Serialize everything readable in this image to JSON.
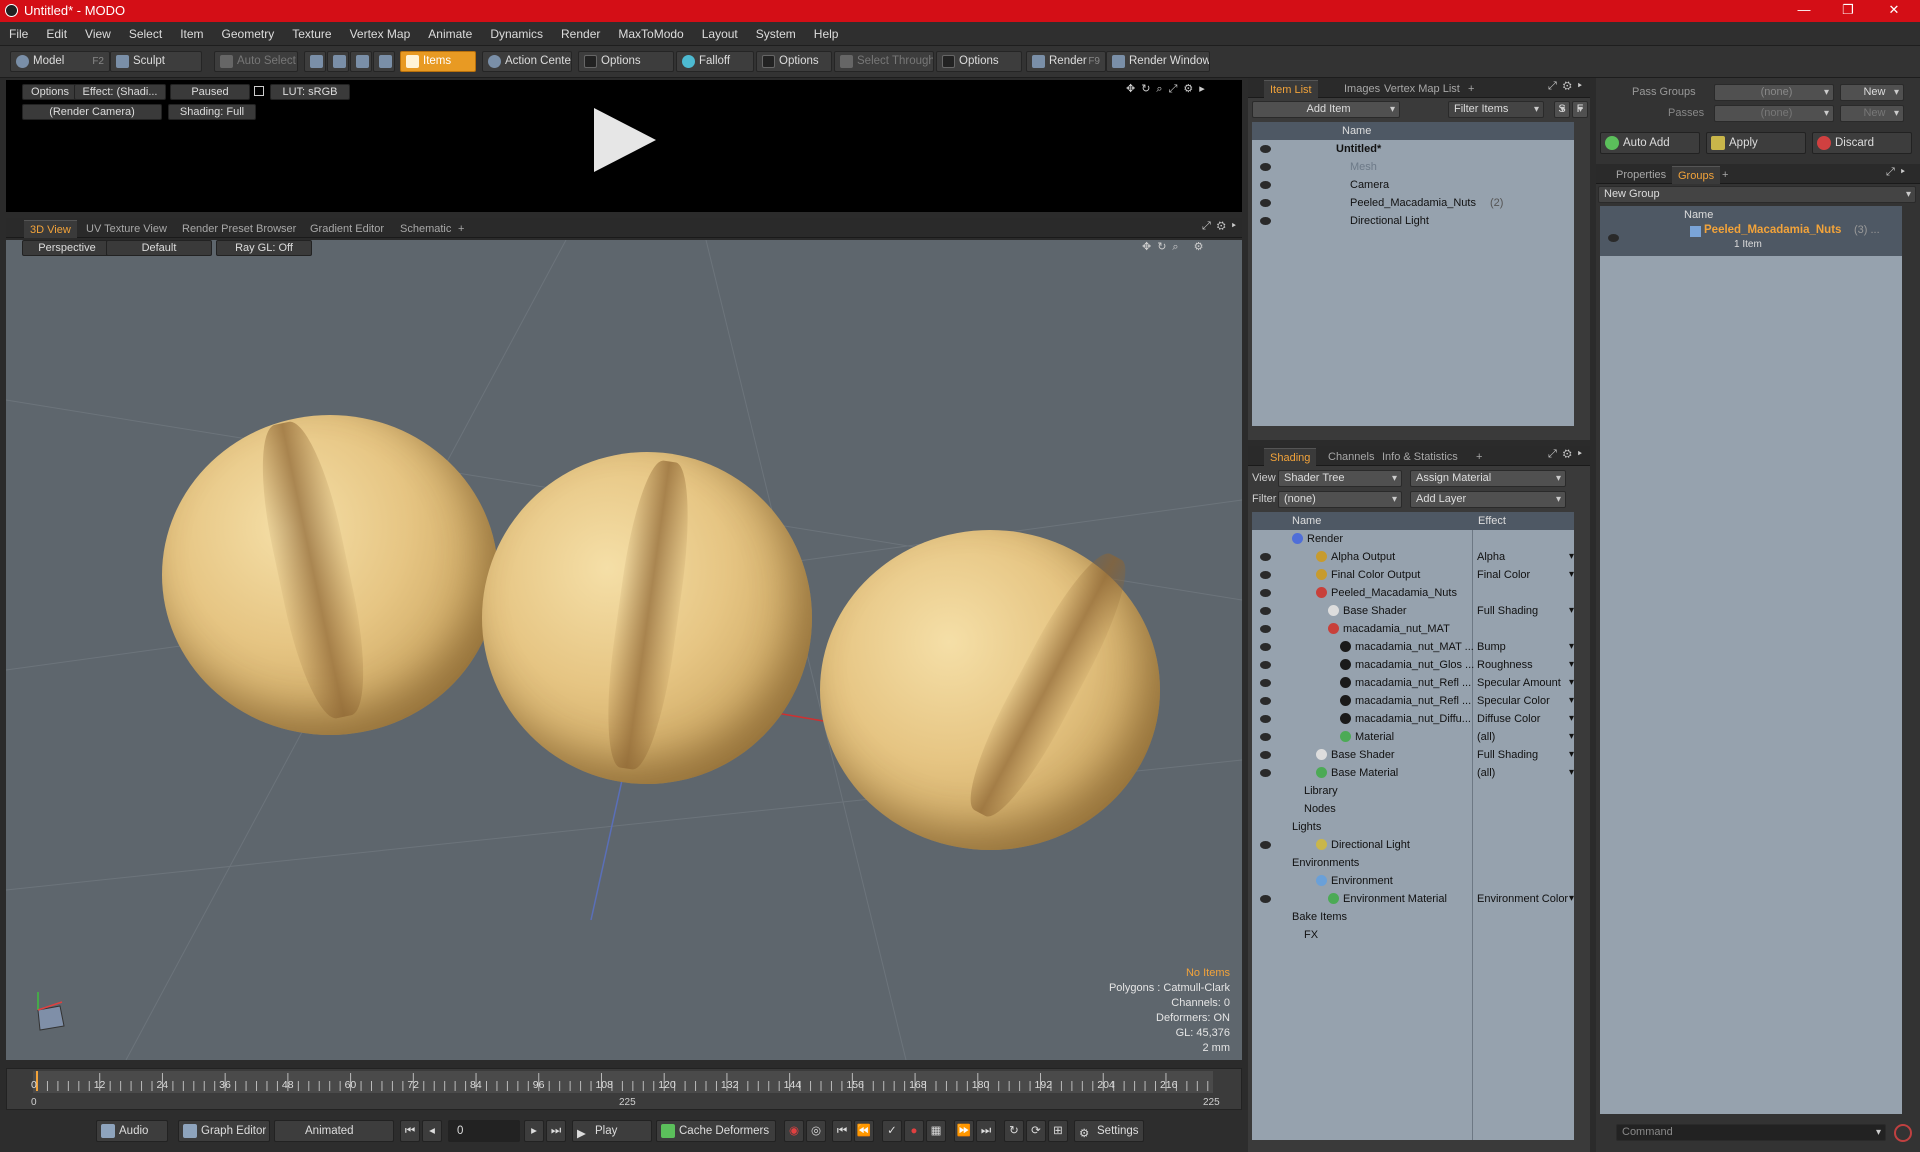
{
  "window": {
    "title": "Untitled* - MODO",
    "controls": [
      "—",
      "❐",
      "✕"
    ]
  },
  "menu": [
    "File",
    "Edit",
    "View",
    "Select",
    "Item",
    "Geometry",
    "Texture",
    "Vertex Map",
    "Animate",
    "Dynamics",
    "Render",
    "MaxToModo",
    "Layout",
    "System",
    "Help"
  ],
  "toolbar": {
    "model": "Model",
    "model_key": "F2",
    "sculpt": "Sculpt",
    "auto_select": "Auto Select",
    "items": "Items",
    "action_center": "Action Center",
    "options1": "Options",
    "falloff": "Falloff",
    "options2": "Options",
    "select_through": "Select Through",
    "options3": "Options",
    "render": "Render",
    "render_key": "F9",
    "render_window": "Render Window"
  },
  "preview": {
    "options": "Options",
    "effect": "Effect: (Shadi...",
    "paused": "Paused",
    "lut": "LUT: sRGB",
    "camera": "(Render Camera)",
    "shading": "Shading: Full"
  },
  "view_tabs": [
    "3D View",
    "UV Texture View",
    "Render Preset Browser",
    "Gradient Editor",
    "Schematic",
    "+"
  ],
  "view3d": {
    "perspective": "Perspective",
    "default": "Default",
    "raygl": "Ray GL: Off",
    "hud": {
      "no_items": "No Items",
      "polygons": "Polygons : Catmull-Clark",
      "channels": "Channels: 0",
      "deformers": "Deformers: ON",
      "gl": "GL: 45,376",
      "scale": "2 mm"
    }
  },
  "timeline": {
    "ticks": [
      "0",
      "12",
      "24",
      "36",
      "48",
      "60",
      "72",
      "84",
      "96",
      "108",
      "120",
      "132",
      "144",
      "156",
      "168",
      "180",
      "192",
      "204",
      "216"
    ],
    "start": "0",
    "mid": "225",
    "end": "225"
  },
  "bottombar": {
    "audio": "Audio",
    "graph_editor": "Graph Editor",
    "animated": "Animated",
    "frame": "0",
    "play": "Play",
    "cache": "Cache Deformers",
    "settings": "Settings"
  },
  "itemlist": {
    "tabs": [
      "Item List",
      "Images",
      "Vertex Map List",
      "+"
    ],
    "add_item": "Add Item",
    "filter": "Filter Items",
    "f_key": "F",
    "s_key": "S",
    "col_name": "Name",
    "rows": [
      {
        "name": "Untitled*",
        "count": ""
      },
      {
        "name": "Mesh",
        "count": ""
      },
      {
        "name": "Camera",
        "count": ""
      },
      {
        "name": "Peeled_Macadamia_Nuts",
        "count": "(2)"
      },
      {
        "name": "Directional Light",
        "count": ""
      }
    ]
  },
  "shading": {
    "tabs": [
      "Shading",
      "Channels",
      "Info & Statistics",
      "+"
    ],
    "view_label": "View",
    "view_value": "Shader Tree",
    "assign": "Assign Material",
    "filter_label": "Filter",
    "filter_value": "(none)",
    "add_layer": "Add Layer",
    "col_name": "Name",
    "col_effect": "Effect",
    "rows": [
      {
        "name": "Render",
        "effect": "",
        "indent": 0,
        "eye": false,
        "color": "#4f6ed8"
      },
      {
        "name": "Alpha Output",
        "effect": "Alpha",
        "indent": 2,
        "eye": true,
        "color": "#c79b2e"
      },
      {
        "name": "Final Color Output",
        "effect": "Final Color",
        "indent": 2,
        "eye": true,
        "color": "#c79b2e"
      },
      {
        "name": "Peeled_Macadamia_Nuts",
        "effect": "",
        "indent": 2,
        "eye": true,
        "color": "#c8403a"
      },
      {
        "name": "Base Shader",
        "effect": "Full Shading",
        "indent": 3,
        "eye": true,
        "color": "#dddddd"
      },
      {
        "name": "macadamia_nut_MAT",
        "effect": "",
        "indent": 3,
        "eye": true,
        "color": "#c8403a"
      },
      {
        "name": "macadamia_nut_MAT ...",
        "effect": "Bump",
        "indent": 4,
        "eye": true,
        "color": "#1a1a1a"
      },
      {
        "name": "macadamia_nut_Glos ...",
        "effect": "Roughness",
        "indent": 4,
        "eye": true,
        "color": "#1a1a1a"
      },
      {
        "name": "macadamia_nut_Refl ...",
        "effect": "Specular Amount",
        "indent": 4,
        "eye": true,
        "color": "#1a1a1a"
      },
      {
        "name": "macadamia_nut_Refl ...",
        "effect": "Specular Color",
        "indent": 4,
        "eye": true,
        "color": "#1a1a1a"
      },
      {
        "name": "macadamia_nut_Diffu...",
        "effect": "Diffuse Color",
        "indent": 4,
        "eye": true,
        "color": "#1a1a1a"
      },
      {
        "name": "Material",
        "effect": "(all)",
        "indent": 4,
        "eye": true,
        "color": "#4caa55"
      },
      {
        "name": "Base Shader",
        "effect": "Full Shading",
        "indent": 2,
        "eye": true,
        "color": "#dddddd"
      },
      {
        "name": "Base Material",
        "effect": "(all)",
        "indent": 2,
        "eye": true,
        "color": "#4caa55"
      },
      {
        "name": "Library",
        "effect": "",
        "indent": 1,
        "eye": false,
        "color": ""
      },
      {
        "name": "Nodes",
        "effect": "",
        "indent": 1,
        "eye": false,
        "color": ""
      },
      {
        "name": "Lights",
        "effect": "",
        "indent": 0,
        "eye": false,
        "color": ""
      },
      {
        "name": "Directional Light",
        "effect": "",
        "indent": 2,
        "eye": true,
        "color": "#c9b64a"
      },
      {
        "name": "Environments",
        "effect": "",
        "indent": 0,
        "eye": false,
        "color": ""
      },
      {
        "name": "Environment",
        "effect": "",
        "indent": 2,
        "eye": false,
        "color": "#6aa0d8"
      },
      {
        "name": "Environment Material",
        "effect": "Environment Color",
        "indent": 3,
        "eye": true,
        "color": "#4caa55"
      },
      {
        "name": "Bake Items",
        "effect": "",
        "indent": 0,
        "eye": false,
        "color": ""
      },
      {
        "name": "FX",
        "effect": "",
        "indent": 1,
        "eye": false,
        "color": ""
      }
    ]
  },
  "right": {
    "pass_groups": "Pass Groups",
    "pass_none": "(none)",
    "new": "New",
    "passes": "Passes",
    "passes_none": "(none)",
    "new2": "New",
    "auto_add": "Auto Add",
    "apply": "Apply",
    "discard": "Discard",
    "tabs": [
      "Properties",
      "Groups",
      "+"
    ],
    "new_group": "New Group",
    "col_name": "Name",
    "group_name": "Peeled_Macadamia_Nuts",
    "group_count": "(3) ...",
    "group_items": "1 Item",
    "command": "Command"
  },
  "colors": {
    "accent": "#e89a23",
    "titlebar": "#d40e16",
    "list_bg": "#96a2ae"
  }
}
